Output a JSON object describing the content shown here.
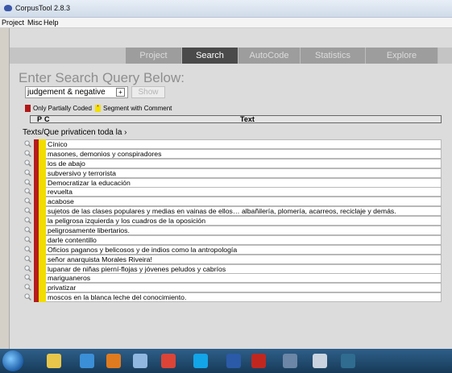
{
  "window": {
    "title": "CorpusTool 2.8.3"
  },
  "menu": [
    "Project",
    "Misc",
    "Help"
  ],
  "tabs": [
    {
      "label": "Project",
      "active": false
    },
    {
      "label": "Search",
      "active": true
    },
    {
      "label": "AutoCode",
      "active": false
    },
    {
      "label": "Statistics",
      "active": false
    },
    {
      "label": "Explore",
      "active": false
    }
  ],
  "search": {
    "heading": "Enter Search Query Below:",
    "query": "judgement & negative",
    "dropdown_glyph": "+",
    "show_label": "Show"
  },
  "legend": {
    "partial_label": "Only Partially Coded",
    "partial_glyph": "",
    "comment_label": "Segment with Comment",
    "comment_glyph": "*"
  },
  "columns": {
    "p": "P",
    "c": "C",
    "text": "Text"
  },
  "path": "Texts/Que privaticen toda la ›",
  "results": [
    "Cínico",
    "masones, demonios y conspiradores",
    "los de abajo",
    "subversivo y terrorista",
    "Democratizar la educación",
    "revuelta",
    "acabose",
    "sujetos de las clases populares y medias en vainas de ellos… albañilería, plomería, acarreos, reciclaje y demás.",
    "la peligrosa izquierda y los cuadros de la oposición",
    "peligrosamente libertarios.",
    "darle contentillo",
    "Oficios paganos y belicosos y de indios como la antropología",
    "señor anarquista Morales Riveira!",
    "lupanar de niñas pierní-flojas y jóvenes peludos y cabríos",
    "mariguaneros",
    "privatizar",
    "moscos en la blanca leche del conocimiento."
  ],
  "scroll_arrow": "◂",
  "taskbar": {
    "apps": [
      "file-explorer-icon",
      "internet-explorer-icon",
      "media-player-icon",
      "paint-icon",
      "chrome-icon",
      "skype-icon",
      "word-icon",
      "acrobat-icon",
      "corpustool-icon",
      "document-icon",
      "python-icon"
    ]
  },
  "colors": {
    "partial": "#b51c1c",
    "comment": "#f2dd00",
    "active_tab": "#4a4a4a"
  }
}
